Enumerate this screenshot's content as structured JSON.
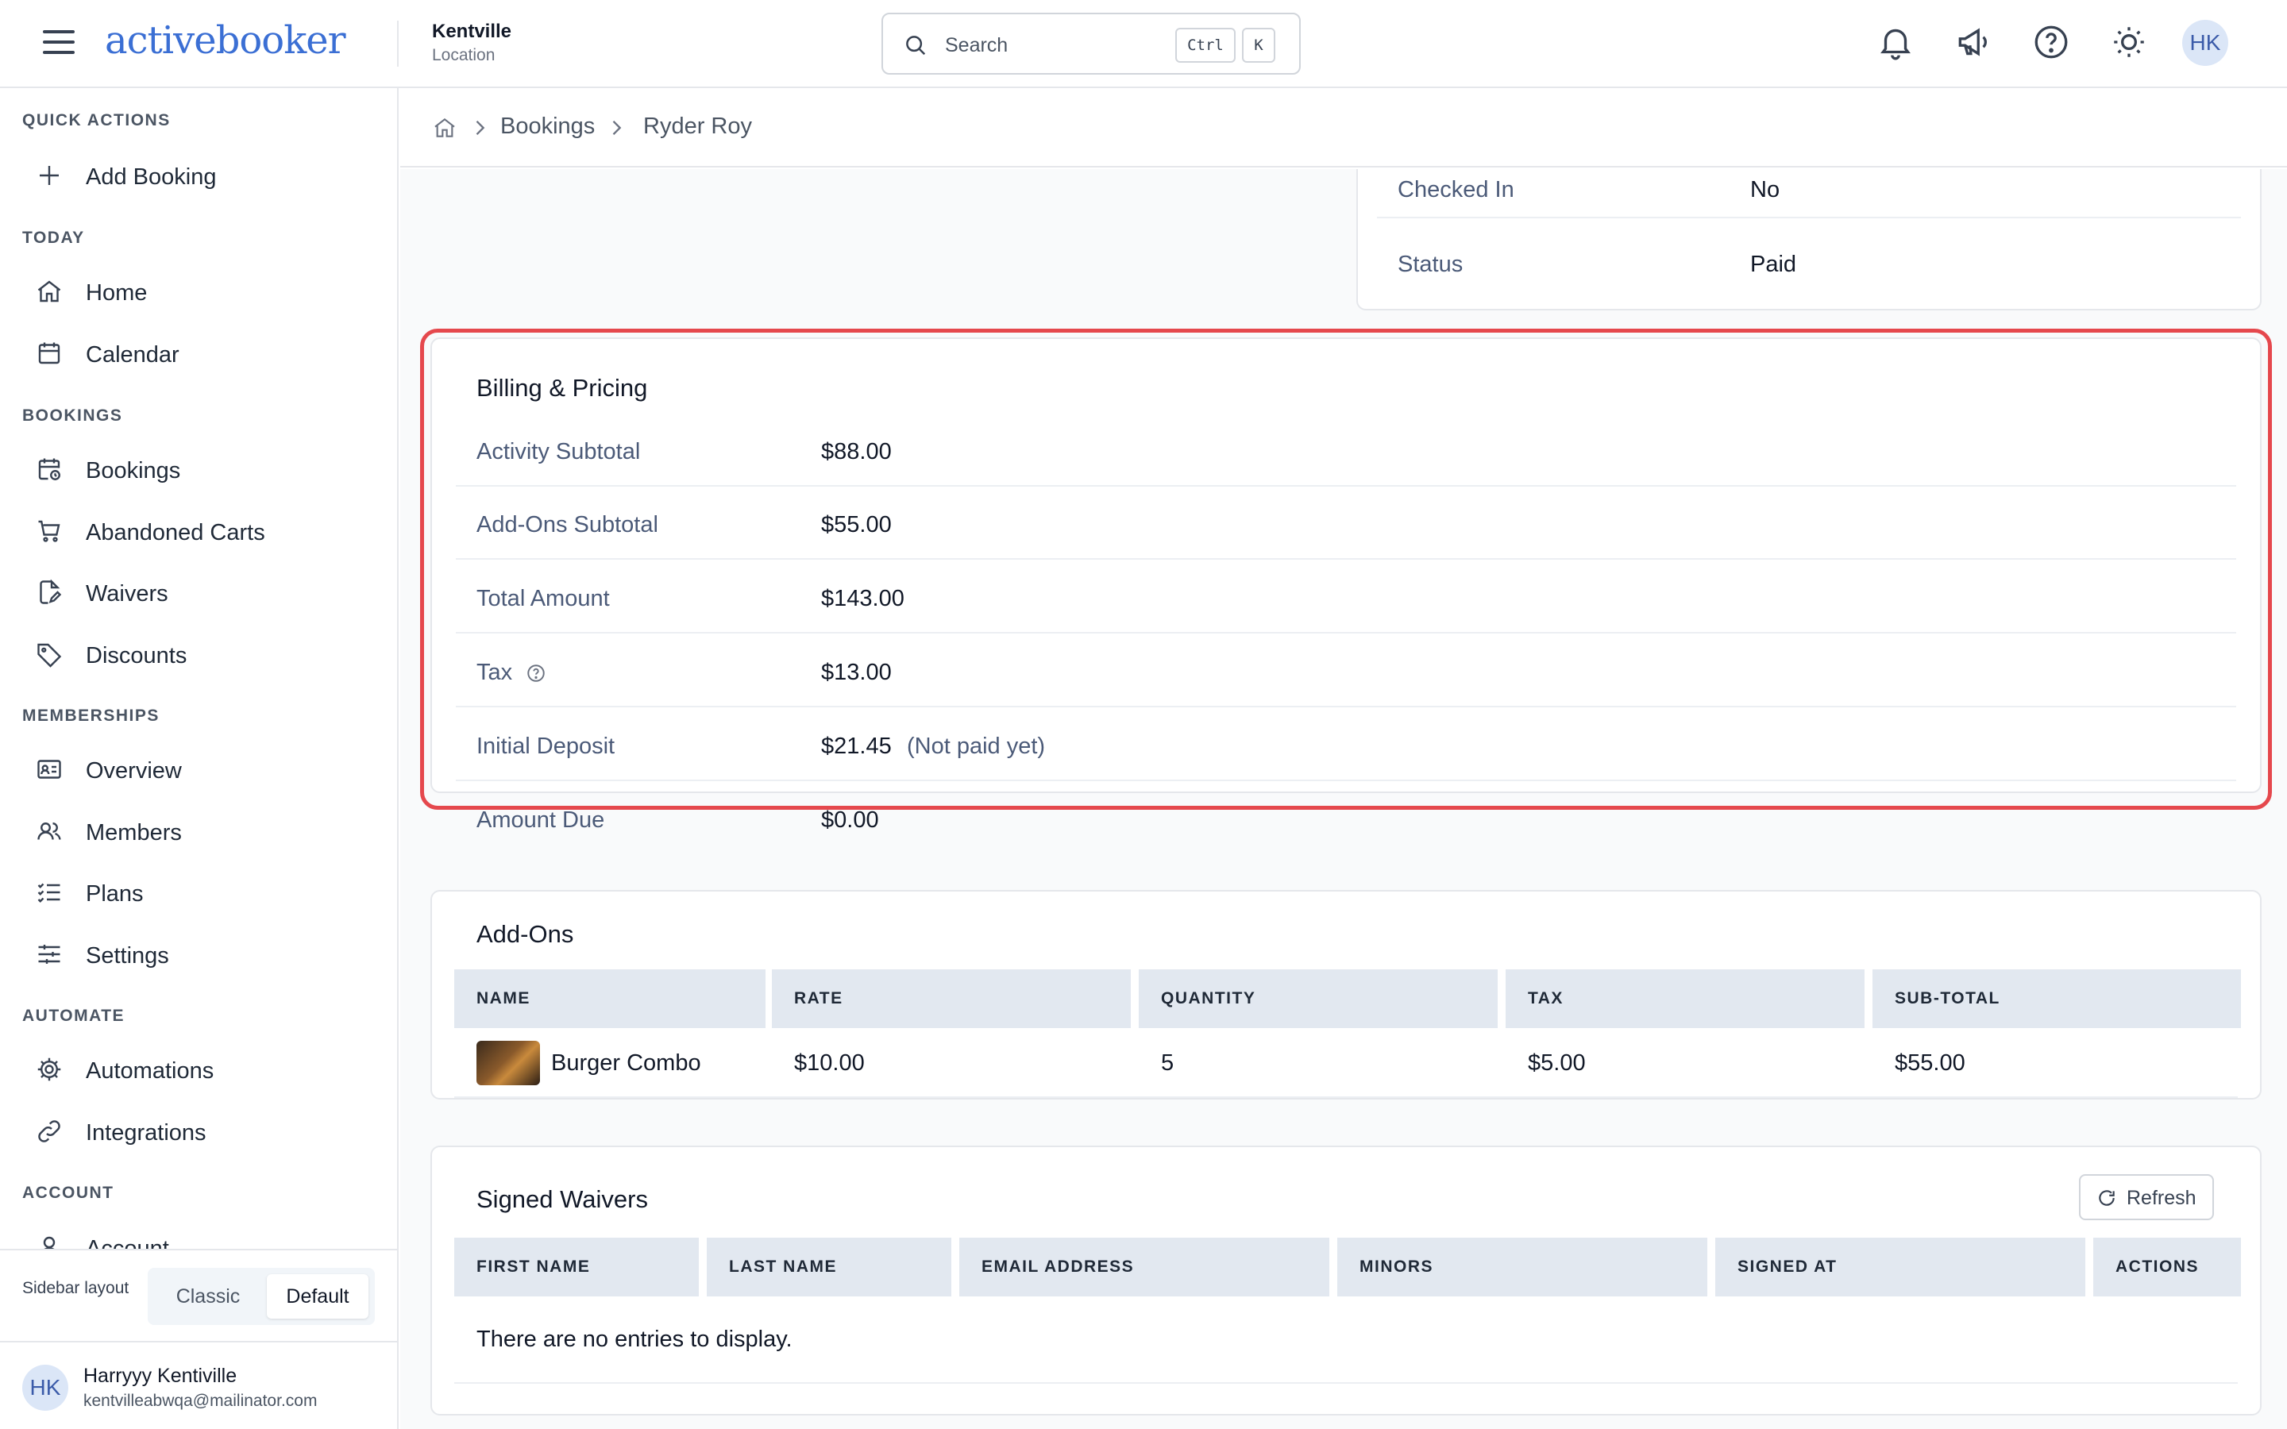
{
  "app": {
    "logo_text": "activebooker"
  },
  "location": {
    "name": "Kentville",
    "label": "Location"
  },
  "search": {
    "placeholder": "Search",
    "shortcut_ctrl": "Ctrl",
    "shortcut_key": "K"
  },
  "header_icons": [
    "bell-icon",
    "megaphone-icon",
    "help-icon",
    "sun-icon"
  ],
  "user_initials": "HK",
  "sidebar": {
    "sections": {
      "quick_actions": "QUICK ACTIONS",
      "today": "TODAY",
      "bookings": "BOOKINGS",
      "memberships": "MEMBERSHIPS",
      "automate": "AUTOMATE",
      "account": "ACCOUNT"
    },
    "items": {
      "add_booking": "Add Booking",
      "home": "Home",
      "calendar": "Calendar",
      "bookings": "Bookings",
      "abandoned_carts": "Abandoned Carts",
      "waivers": "Waivers",
      "discounts": "Discounts",
      "overview": "Overview",
      "members": "Members",
      "plans": "Plans",
      "settings": "Settings",
      "automations": "Automations",
      "integrations": "Integrations",
      "account": "Account"
    },
    "layout": {
      "label": "Sidebar layout",
      "options": [
        "Classic",
        "Default"
      ],
      "selected": "Default"
    },
    "user": {
      "initials": "HK",
      "name": "Harryyy Kentiville",
      "email": "kentvilleabwqa@mailinator.com"
    }
  },
  "breadcrumb": {
    "items": [
      "Bookings",
      "Ryder Roy"
    ]
  },
  "booking_status": {
    "checked_in_label": "Checked In",
    "checked_in_value": "No",
    "status_label": "Status",
    "status_value": "Paid"
  },
  "billing": {
    "title": "Billing & Pricing",
    "rows": [
      {
        "label": "Activity Subtotal",
        "value": "$88.00"
      },
      {
        "label": "Add-Ons Subtotal",
        "value": "$55.00"
      },
      {
        "label": "Total Amount",
        "value": "$143.00"
      },
      {
        "label": "Tax",
        "value": "$13.00"
      },
      {
        "label": "Initial Deposit",
        "value": "$21.45",
        "note": "(Not paid yet)"
      },
      {
        "label": "Amount Due",
        "value": "$0.00"
      }
    ],
    "highlight_color": "#e5484d"
  },
  "addons": {
    "title": "Add-Ons",
    "columns": [
      "NAME",
      "RATE",
      "QUANTITY",
      "TAX",
      "SUB-TOTAL"
    ],
    "rows": [
      {
        "name": "Burger Combo",
        "rate": "$10.00",
        "quantity": "5",
        "tax": "$5.00",
        "subtotal": "$55.00"
      }
    ]
  },
  "waivers": {
    "title": "Signed Waivers",
    "refresh_label": "Refresh",
    "columns": [
      "FIRST NAME",
      "LAST NAME",
      "EMAIL ADDRESS",
      "MINORS",
      "SIGNED AT",
      "ACTIONS"
    ],
    "empty_text": "There are no entries to display."
  },
  "colors": {
    "accent": "#3b6fd4",
    "table_header": "#e2e8f0",
    "highlight": "#e5484d"
  }
}
